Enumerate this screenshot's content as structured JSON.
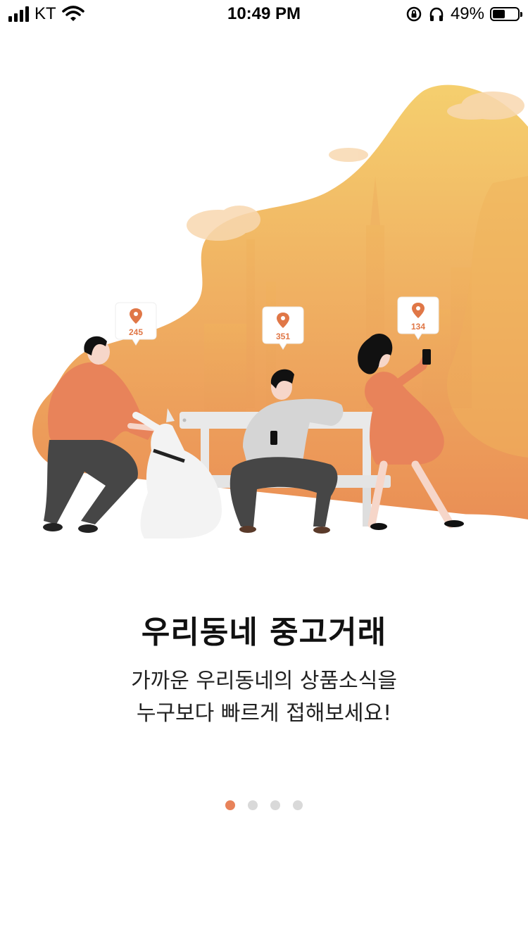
{
  "status_bar": {
    "carrier": "KT",
    "time": "10:49 PM",
    "battery_percent": "49%",
    "battery_level": 0.49,
    "icons": [
      "signal-icon",
      "wifi-icon",
      "orientation-lock-icon",
      "headphones-icon",
      "battery-icon"
    ]
  },
  "illustration": {
    "pins": [
      {
        "count": "245"
      },
      {
        "count": "351"
      },
      {
        "count": "134"
      }
    ],
    "colors": {
      "hill_top": "#f5cf6e",
      "hill_bottom": "#ea8f55",
      "shirt": "#e8835a",
      "pin": "#e07747"
    }
  },
  "onboarding": {
    "title": "우리동네 중고거래",
    "description_line1": "가까운 우리동네의 상품소식을",
    "description_line2": "누구보다 빠르게 접해보세요!"
  },
  "pager": {
    "count": 4,
    "active_index": 0,
    "active_color": "#e8835a",
    "inactive_color": "#d9d9d9"
  }
}
